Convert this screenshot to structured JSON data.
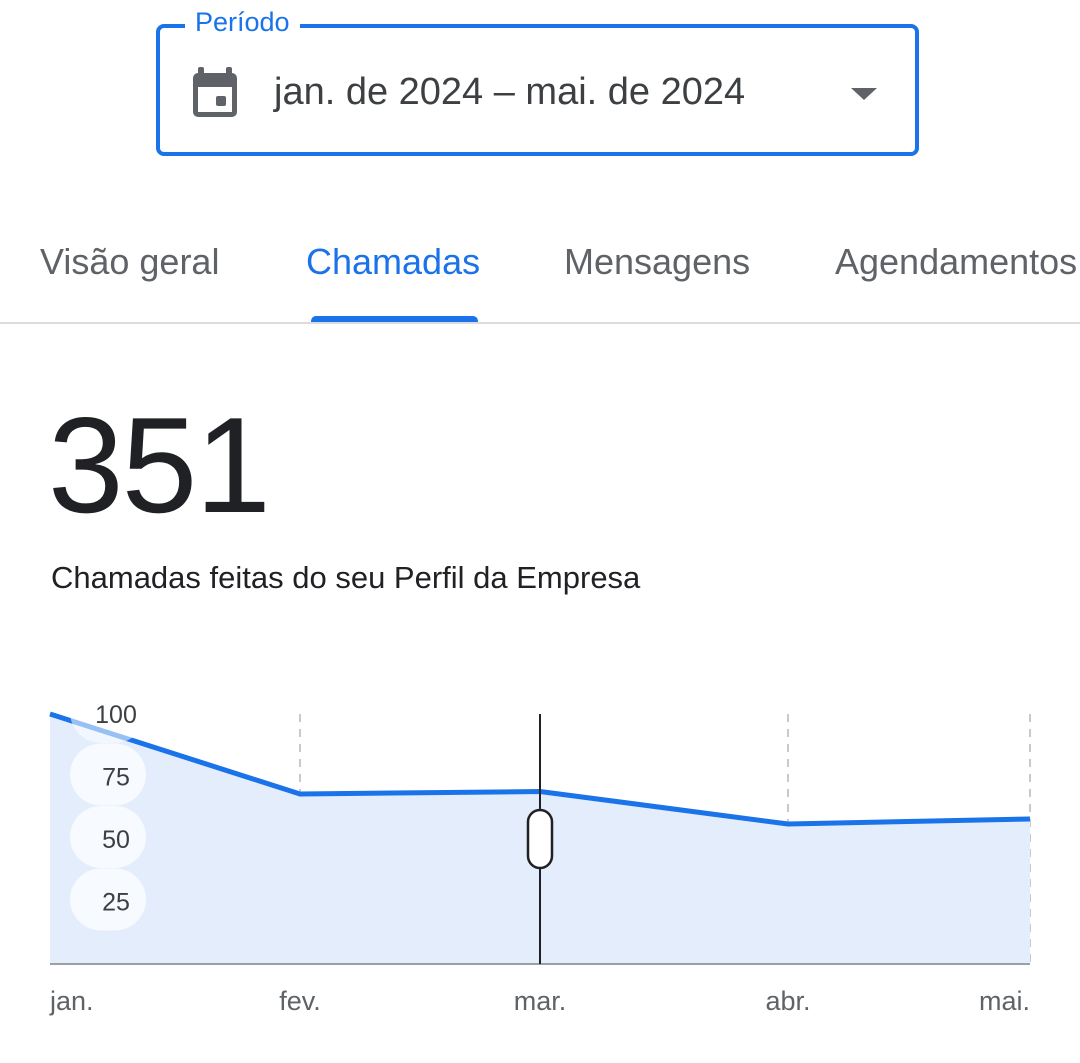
{
  "period": {
    "label": "Período",
    "value": "jan. de 2024 – mai. de 2024",
    "icons": [
      "calendar-icon",
      "dropdown-arrow-icon"
    ]
  },
  "tabs": [
    {
      "label": "Visão geral",
      "active": false
    },
    {
      "label": "Chamadas",
      "active": true
    },
    {
      "label": "Mensagens",
      "active": false
    },
    {
      "label": "Agendamentos",
      "active": false
    }
  ],
  "metric": {
    "value": "351",
    "caption": "Chamadas feitas do seu Perfil da Empresa"
  },
  "colors": {
    "accent": "#1a73e8",
    "line": "#1a73e8",
    "area": "#e3edfc"
  },
  "chart_data": {
    "type": "area",
    "categories": [
      "jan.",
      "fev.",
      "mar.",
      "abr.",
      "mai."
    ],
    "series": [
      {
        "values": [
          100,
          68,
          69,
          56,
          58
        ]
      }
    ],
    "y_ticks": [
      100,
      75,
      50,
      25
    ],
    "ylim": [
      0,
      100
    ],
    "selected_category": "mar.",
    "grid": "vertical-dashed"
  }
}
